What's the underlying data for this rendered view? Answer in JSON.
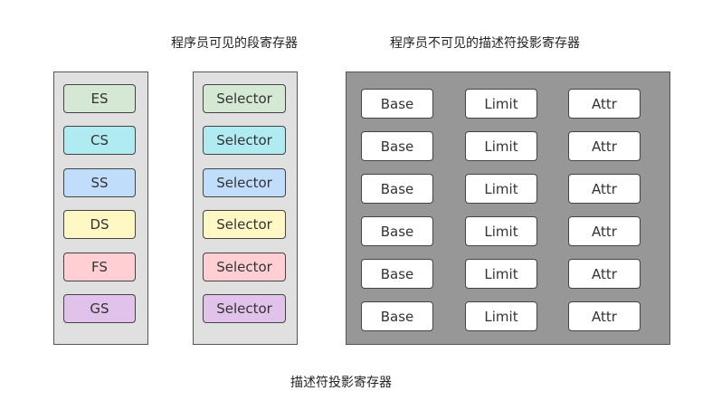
{
  "captions": {
    "visible_registers": "程序员可见的段寄存器",
    "hidden_registers": "程序员不可见的描述符投影寄存器",
    "bottom": "描述符投影寄存器"
  },
  "segments": [
    {
      "name": "ES",
      "selector": "Selector",
      "color": "#d5e8d4"
    },
    {
      "name": "CS",
      "selector": "Selector",
      "color": "#b1ebf2"
    },
    {
      "name": "SS",
      "selector": "Selector",
      "color": "#c0defc"
    },
    {
      "name": "DS",
      "selector": "Selector",
      "color": "#fff8c4"
    },
    {
      "name": "FS",
      "selector": "Selector",
      "color": "#ffcfd4"
    },
    {
      "name": "GS",
      "selector": "Selector",
      "color": "#e1c2eb"
    }
  ],
  "descriptor_rows": [
    [
      "Base",
      "Limit",
      "Attr"
    ],
    [
      "Base",
      "Limit",
      "Attr"
    ],
    [
      "Base",
      "Limit",
      "Attr"
    ],
    [
      "Base",
      "Limit",
      "Attr"
    ],
    [
      "Base",
      "Limit",
      "Attr"
    ],
    [
      "Base",
      "Limit",
      "Attr"
    ]
  ],
  "colors": {
    "light_panel": "#e0e0e0",
    "dark_panel": "#979797",
    "descriptor_cell": "#ffffff"
  }
}
